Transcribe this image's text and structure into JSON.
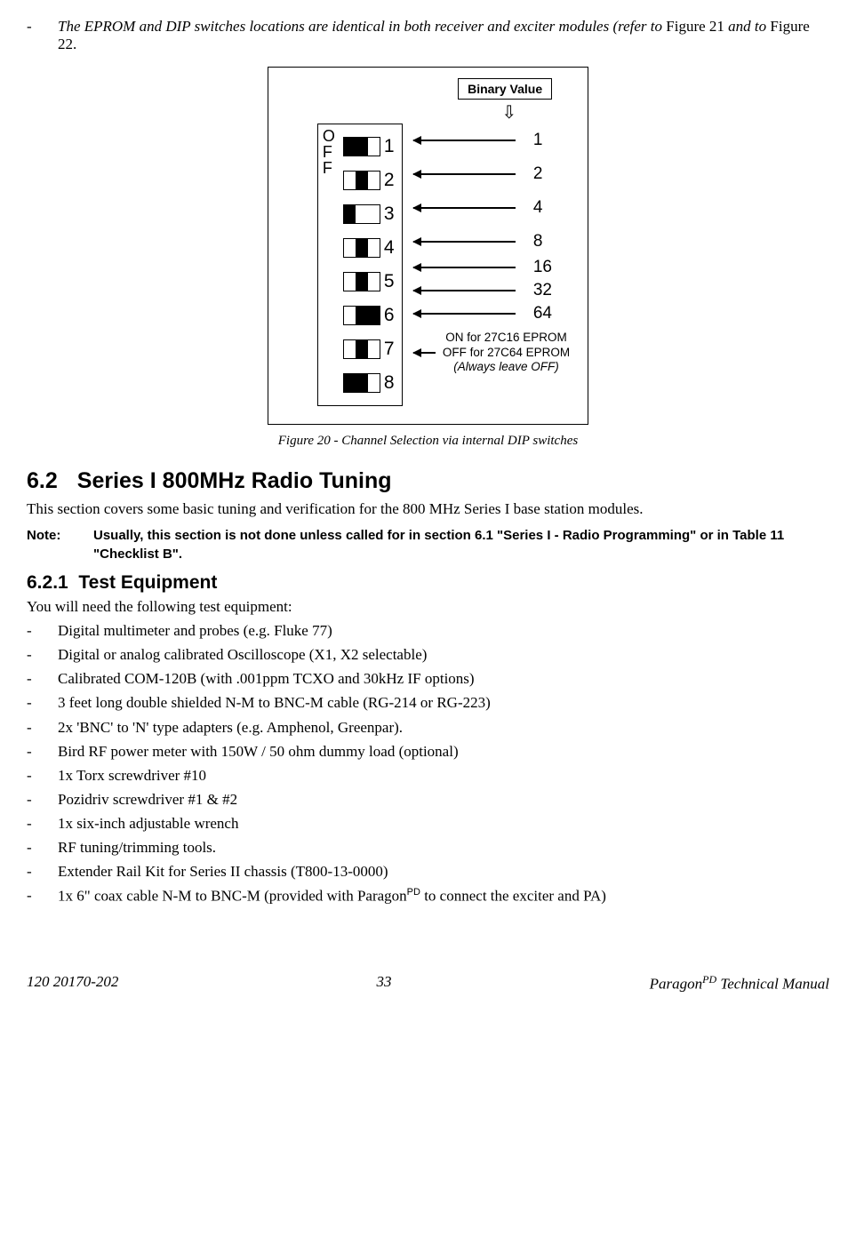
{
  "intro": {
    "text_italic": "The EPROM and DIP switches locations are identical in both receiver and exciter modules (refer to ",
    "fig1": "Figure 21",
    "mid": " and to ",
    "fig2": "Figure 22",
    "end": "."
  },
  "figure": {
    "binary_label": "Binary Value",
    "off_label": "OFF",
    "switches": [
      {
        "num": "1",
        "pattern": [
          "filled",
          "filled",
          "empty"
        ]
      },
      {
        "num": "2",
        "pattern": [
          "empty",
          "filled",
          "empty"
        ]
      },
      {
        "num": "3",
        "pattern": [
          "filled",
          "empty",
          "empty"
        ]
      },
      {
        "num": "4",
        "pattern": [
          "empty",
          "filled",
          "empty"
        ]
      },
      {
        "num": "5",
        "pattern": [
          "empty",
          "filled",
          "empty"
        ]
      },
      {
        "num": "6",
        "pattern": [
          "empty",
          "filled",
          "filled"
        ]
      },
      {
        "num": "7",
        "pattern": [
          "empty",
          "filled",
          "empty"
        ]
      },
      {
        "num": "8",
        "pattern": [
          "filled",
          "filled",
          "empty"
        ]
      }
    ],
    "values": [
      "1",
      "2",
      "4",
      "8",
      "16",
      "32",
      "64"
    ],
    "eprom_line1": "ON for 27C16 EPROM",
    "eprom_line2": "OFF for 27C64 EPROM",
    "eprom_line3": "(Always leave OFF)",
    "caption": "Figure 20 - Channel Selection via internal DIP switches"
  },
  "section": {
    "num": "6.2",
    "title": "Series I 800MHz Radio Tuning",
    "body": "This section covers some basic tuning and verification for the 800 MHz Series I base station modules."
  },
  "note": {
    "label": "Note:",
    "text": "Usually, this section is not done unless called for in section 6.1 \"Series I - Radio Programming\" or in Table 11 \"Checklist B\"."
  },
  "subsection": {
    "num": "6.2.1",
    "title": "Test Equipment",
    "intro": "You will need the following test equipment:"
  },
  "equipment": [
    "Digital multimeter and probes (e.g. Fluke 77)",
    "Digital or analog calibrated Oscilloscope (X1, X2 selectable)",
    "Calibrated COM-120B (with .001ppm TCXO and 30kHz IF options)",
    "3 feet long double shielded N-M to BNC-M cable (RG-214 or RG-223)",
    "2x 'BNC' to 'N' type adapters (e.g. Amphenol, Greenpar).",
    "Bird RF power meter with 150W / 50 ohm dummy load (optional)",
    "1x Torx screwdriver #10",
    "Pozidriv screwdriver #1 & #2",
    "1x six-inch adjustable wrench",
    "RF tuning/trimming tools.",
    "Extender Rail Kit for Series II chassis (T800-13-0000)"
  ],
  "equipment_last": {
    "pre": "1x  6\" coax cable N-M to BNC-M (provided with Paragon",
    "sup": "PD",
    "post": " to connect the exciter and PA)"
  },
  "footer": {
    "left": "120 20170-202",
    "center": "33",
    "right_pre": "Paragon",
    "right_sup": "PD",
    "right_post": " Technical Manual"
  }
}
